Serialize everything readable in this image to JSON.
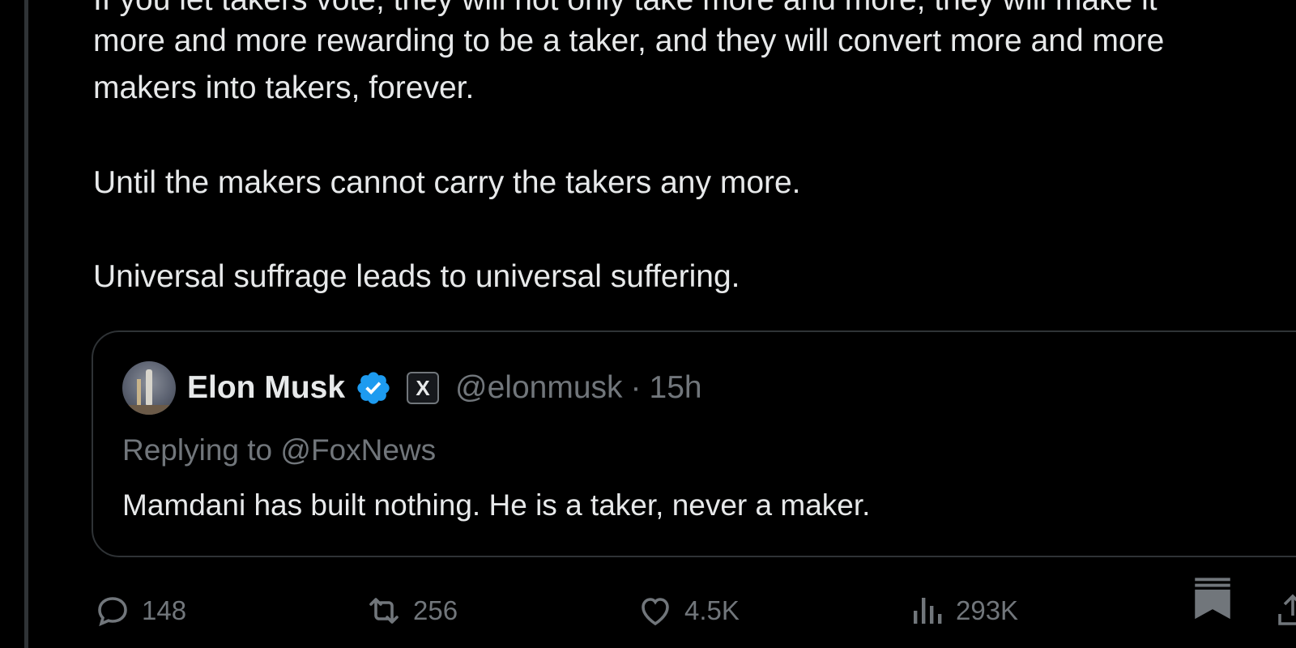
{
  "post": {
    "para_cut": "If you let takers vote, they will not only take more and more, they will make it",
    "para_line2": "more and more rewarding to be a taker, and they will convert more and more",
    "para_line3": "makers into takers, forever.",
    "para_line4": "Until the makers cannot carry the takers any more.",
    "para_line5": "Universal suffrage leads to universal suffering."
  },
  "quote": {
    "name": "Elon Musk",
    "badge_letter": "X",
    "handle": "@elonmusk",
    "separator": "·",
    "time": "15h",
    "replying": "Replying to @FoxNews",
    "text": "Mamdani has built nothing. He is a taker, never a maker."
  },
  "actions": {
    "replies": "148",
    "reposts": "256",
    "likes": "4.5K",
    "views": "293K"
  },
  "icons": {
    "reply": "reply-icon",
    "repost": "repost-icon",
    "like": "heart-icon",
    "views": "views-icon",
    "bookmark": "bookmark-icon",
    "share": "share-icon",
    "verified": "verified-badge-icon"
  },
  "colors": {
    "background": "#000000",
    "text": "#e7e9ea",
    "muted": "#71767b",
    "border": "#2f3336",
    "verified": "#1d9bf0"
  }
}
